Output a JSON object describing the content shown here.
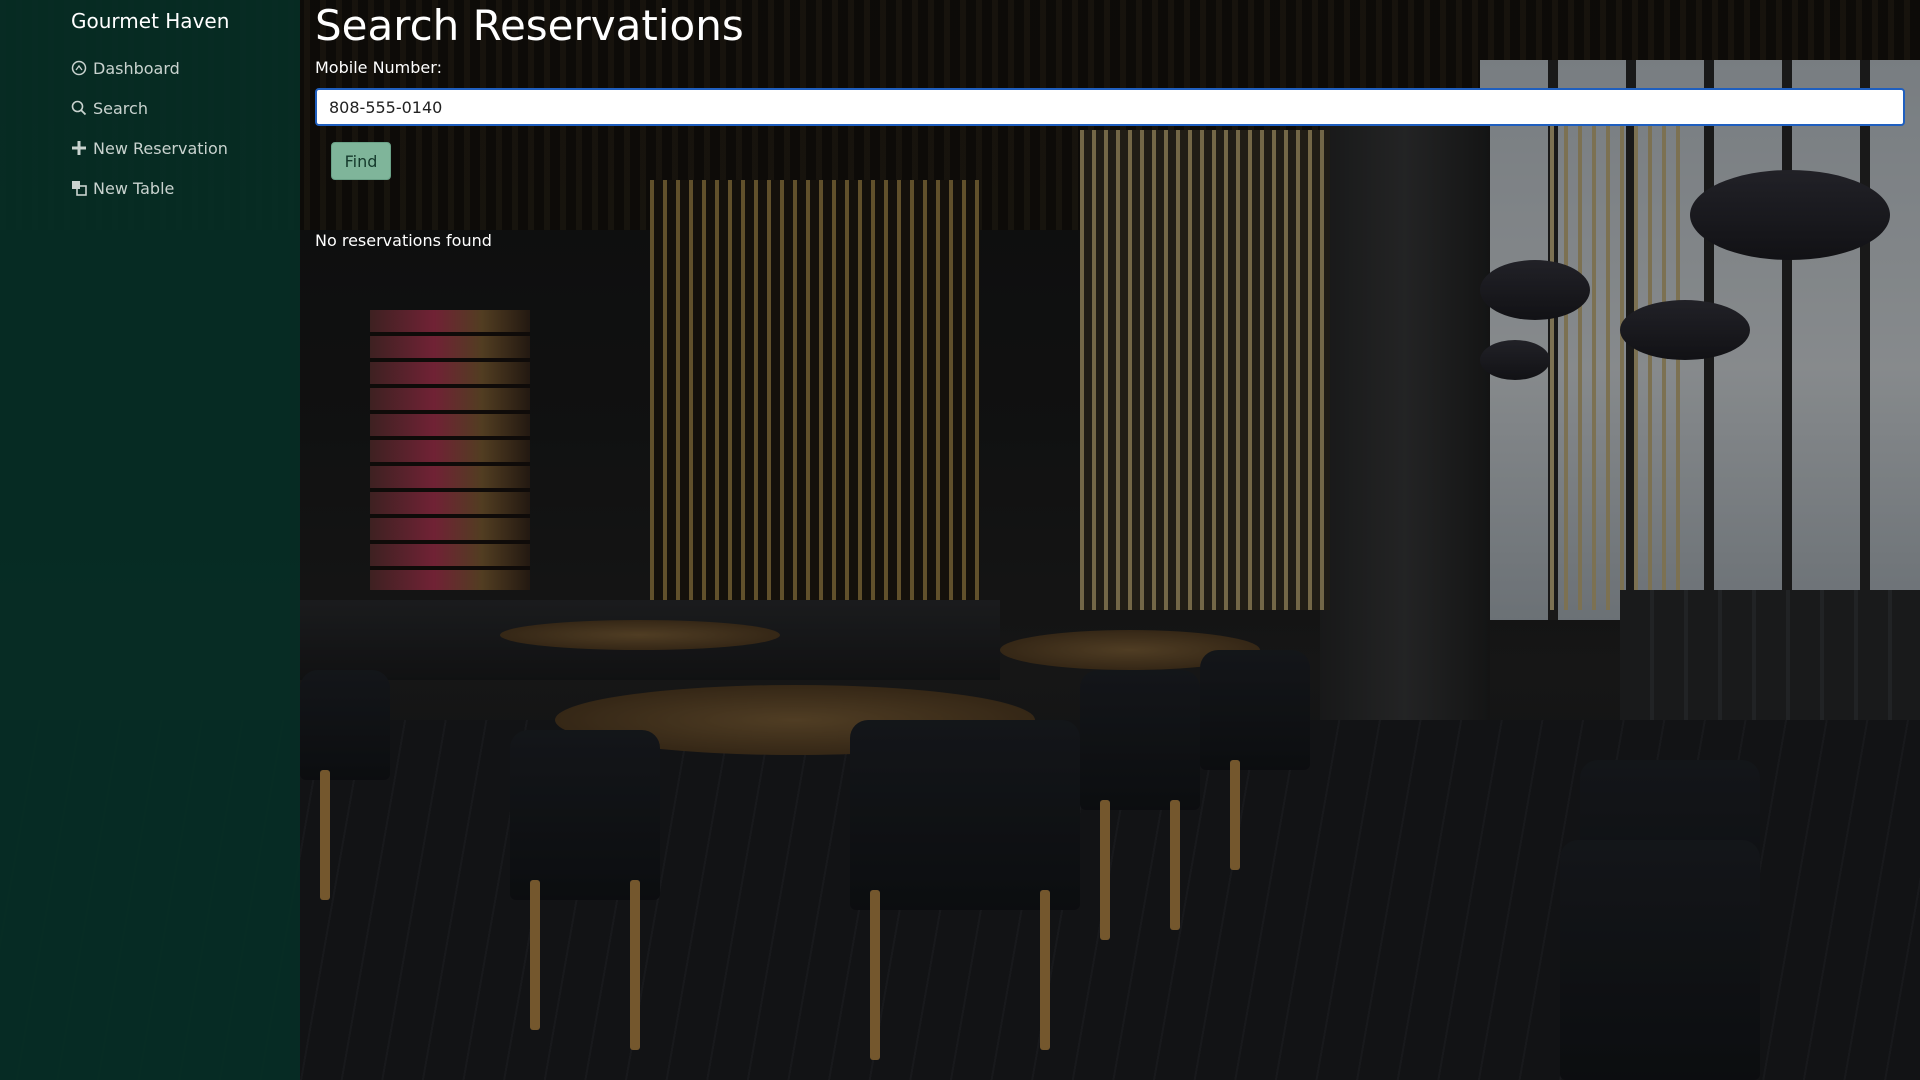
{
  "sidebar": {
    "brand": "Gourmet Haven",
    "items": [
      {
        "label": "Dashboard",
        "icon": "dashboard-icon"
      },
      {
        "label": "Search",
        "icon": "search-icon"
      },
      {
        "label": "New Reservation",
        "icon": "plus-icon"
      },
      {
        "label": "New Table",
        "icon": "layers-icon"
      }
    ]
  },
  "main": {
    "title": "Search Reservations",
    "mobile_label": "Mobile Number:",
    "mobile_value": "808-555-0140",
    "find_label": "Find",
    "status": "No reservations found"
  },
  "colors": {
    "sidebar_bg": "#062f26",
    "button_bg": "#7fb59a",
    "input_focus_border": "#1f5fbf",
    "text": "#ffffff"
  }
}
